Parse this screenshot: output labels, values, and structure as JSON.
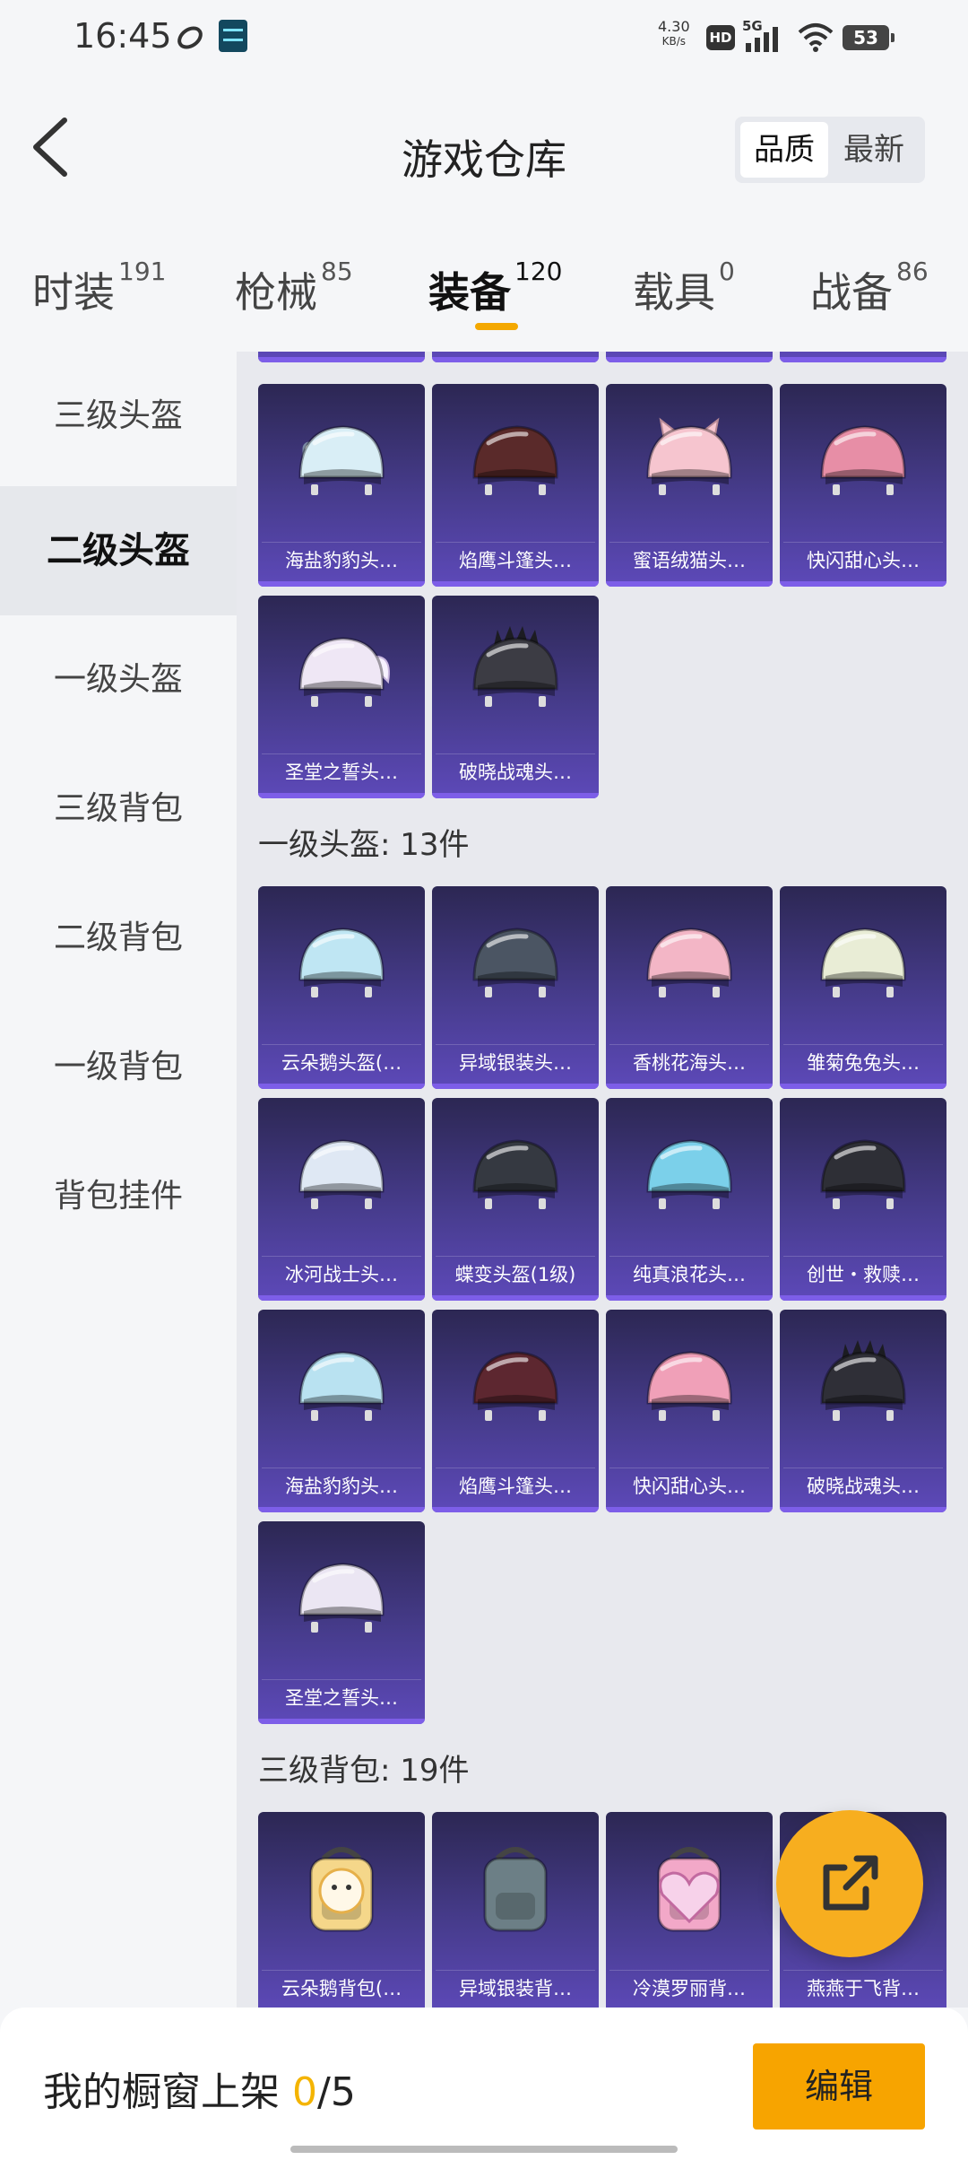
{
  "status_bar": {
    "time": "16:45",
    "net_speed_value": "4.30",
    "net_speed_unit": "KB/s",
    "hd": "HD",
    "network": "5G",
    "battery": "53"
  },
  "header": {
    "title": "游戏仓库",
    "sort_options": [
      "品质",
      "最新"
    ],
    "active_sort": "品质"
  },
  "tabs": [
    {
      "label": "时装",
      "count": "191"
    },
    {
      "label": "枪械",
      "count": "85"
    },
    {
      "label": "装备",
      "count": "120"
    },
    {
      "label": "载具",
      "count": "0"
    },
    {
      "label": "战备",
      "count": "86"
    }
  ],
  "active_tab": "装备",
  "sidebar": {
    "items": [
      "三级头盔",
      "二级头盔",
      "一级头盔",
      "三级背包",
      "二级背包",
      "一级背包",
      "背包挂件"
    ],
    "active": "二级头盔"
  },
  "content": {
    "helmets_level2": [
      {
        "name": "海盐豹豹头…",
        "icon": "helmet-visor-icon",
        "color": "#d9eef6"
      },
      {
        "name": "焰鹰斗篷头…",
        "icon": "helmet-icon",
        "color": "#5a2a2a"
      },
      {
        "name": "蜜语绒猫头…",
        "icon": "helmet-cat-icon",
        "color": "#f6c5cf"
      },
      {
        "name": "快闪甜心头…",
        "icon": "helmet-icon",
        "color": "#e78ea6"
      },
      {
        "name": "圣堂之誓头…",
        "icon": "helmet-wing-icon",
        "color": "#efe7f5"
      },
      {
        "name": "破晓战魂头…",
        "icon": "helmet-spike-icon",
        "color": "#3c3c44"
      }
    ],
    "section_level1": "一级头盔: 13件",
    "helmets_level1": [
      {
        "name": "云朵鹅头盔(…",
        "icon": "helmet-icon",
        "color": "#bfe6f3"
      },
      {
        "name": "异域银装头…",
        "icon": "helmet-icon",
        "color": "#4b5563"
      },
      {
        "name": "香桃花海头…",
        "icon": "helmet-icon",
        "color": "#f3b6c6"
      },
      {
        "name": "雏菊兔兔头…",
        "icon": "helmet-icon",
        "color": "#e9edd6"
      },
      {
        "name": "冰河战士头…",
        "icon": "helmet-icon",
        "color": "#dfe8f4"
      },
      {
        "name": "蝶变头盔(1级)",
        "icon": "helmet-icon",
        "color": "#353941"
      },
      {
        "name": "纯真浪花头…",
        "icon": "helmet-icon",
        "color": "#7bd0ea"
      },
      {
        "name": "创世・救赎…",
        "icon": "helmet-icon",
        "color": "#2e2f36"
      },
      {
        "name": "海盐豹豹头…",
        "icon": "helmet-icon",
        "color": "#b9e2f1"
      },
      {
        "name": "焰鹰斗篷头…",
        "icon": "helmet-icon",
        "color": "#5d2730"
      },
      {
        "name": "快闪甜心头…",
        "icon": "helmet-icon",
        "color": "#f0a0b8"
      },
      {
        "name": "破晓战魂头…",
        "icon": "helmet-spike-icon",
        "color": "#2f2f37"
      },
      {
        "name": "圣堂之誓头…",
        "icon": "helmet-icon",
        "color": "#ebe6f3"
      }
    ],
    "section_backpack3": "三级背包: 19件",
    "backpacks_level3": [
      {
        "name": "云朵鹅背包(…",
        "icon": "backpack-sheep-icon",
        "color": "#f5d78a"
      },
      {
        "name": "异域银装背…",
        "icon": "backpack-icon",
        "color": "#6c7f86"
      },
      {
        "name": "冷漠罗丽背…",
        "icon": "backpack-heart-icon",
        "color": "#f2a8c8"
      },
      {
        "name": "燕燕于飞背…",
        "icon": "backpack-icon",
        "color": "#c9c0e8"
      }
    ]
  },
  "bottom_bar": {
    "shelf_label": "我的橱窗上架",
    "shelf_current": "0",
    "shelf_total": "/5",
    "edit_label": "编辑"
  },
  "colors": {
    "accent": "#f7a400",
    "card_top": "#2c2753",
    "card_bottom": "#5d49b9"
  }
}
